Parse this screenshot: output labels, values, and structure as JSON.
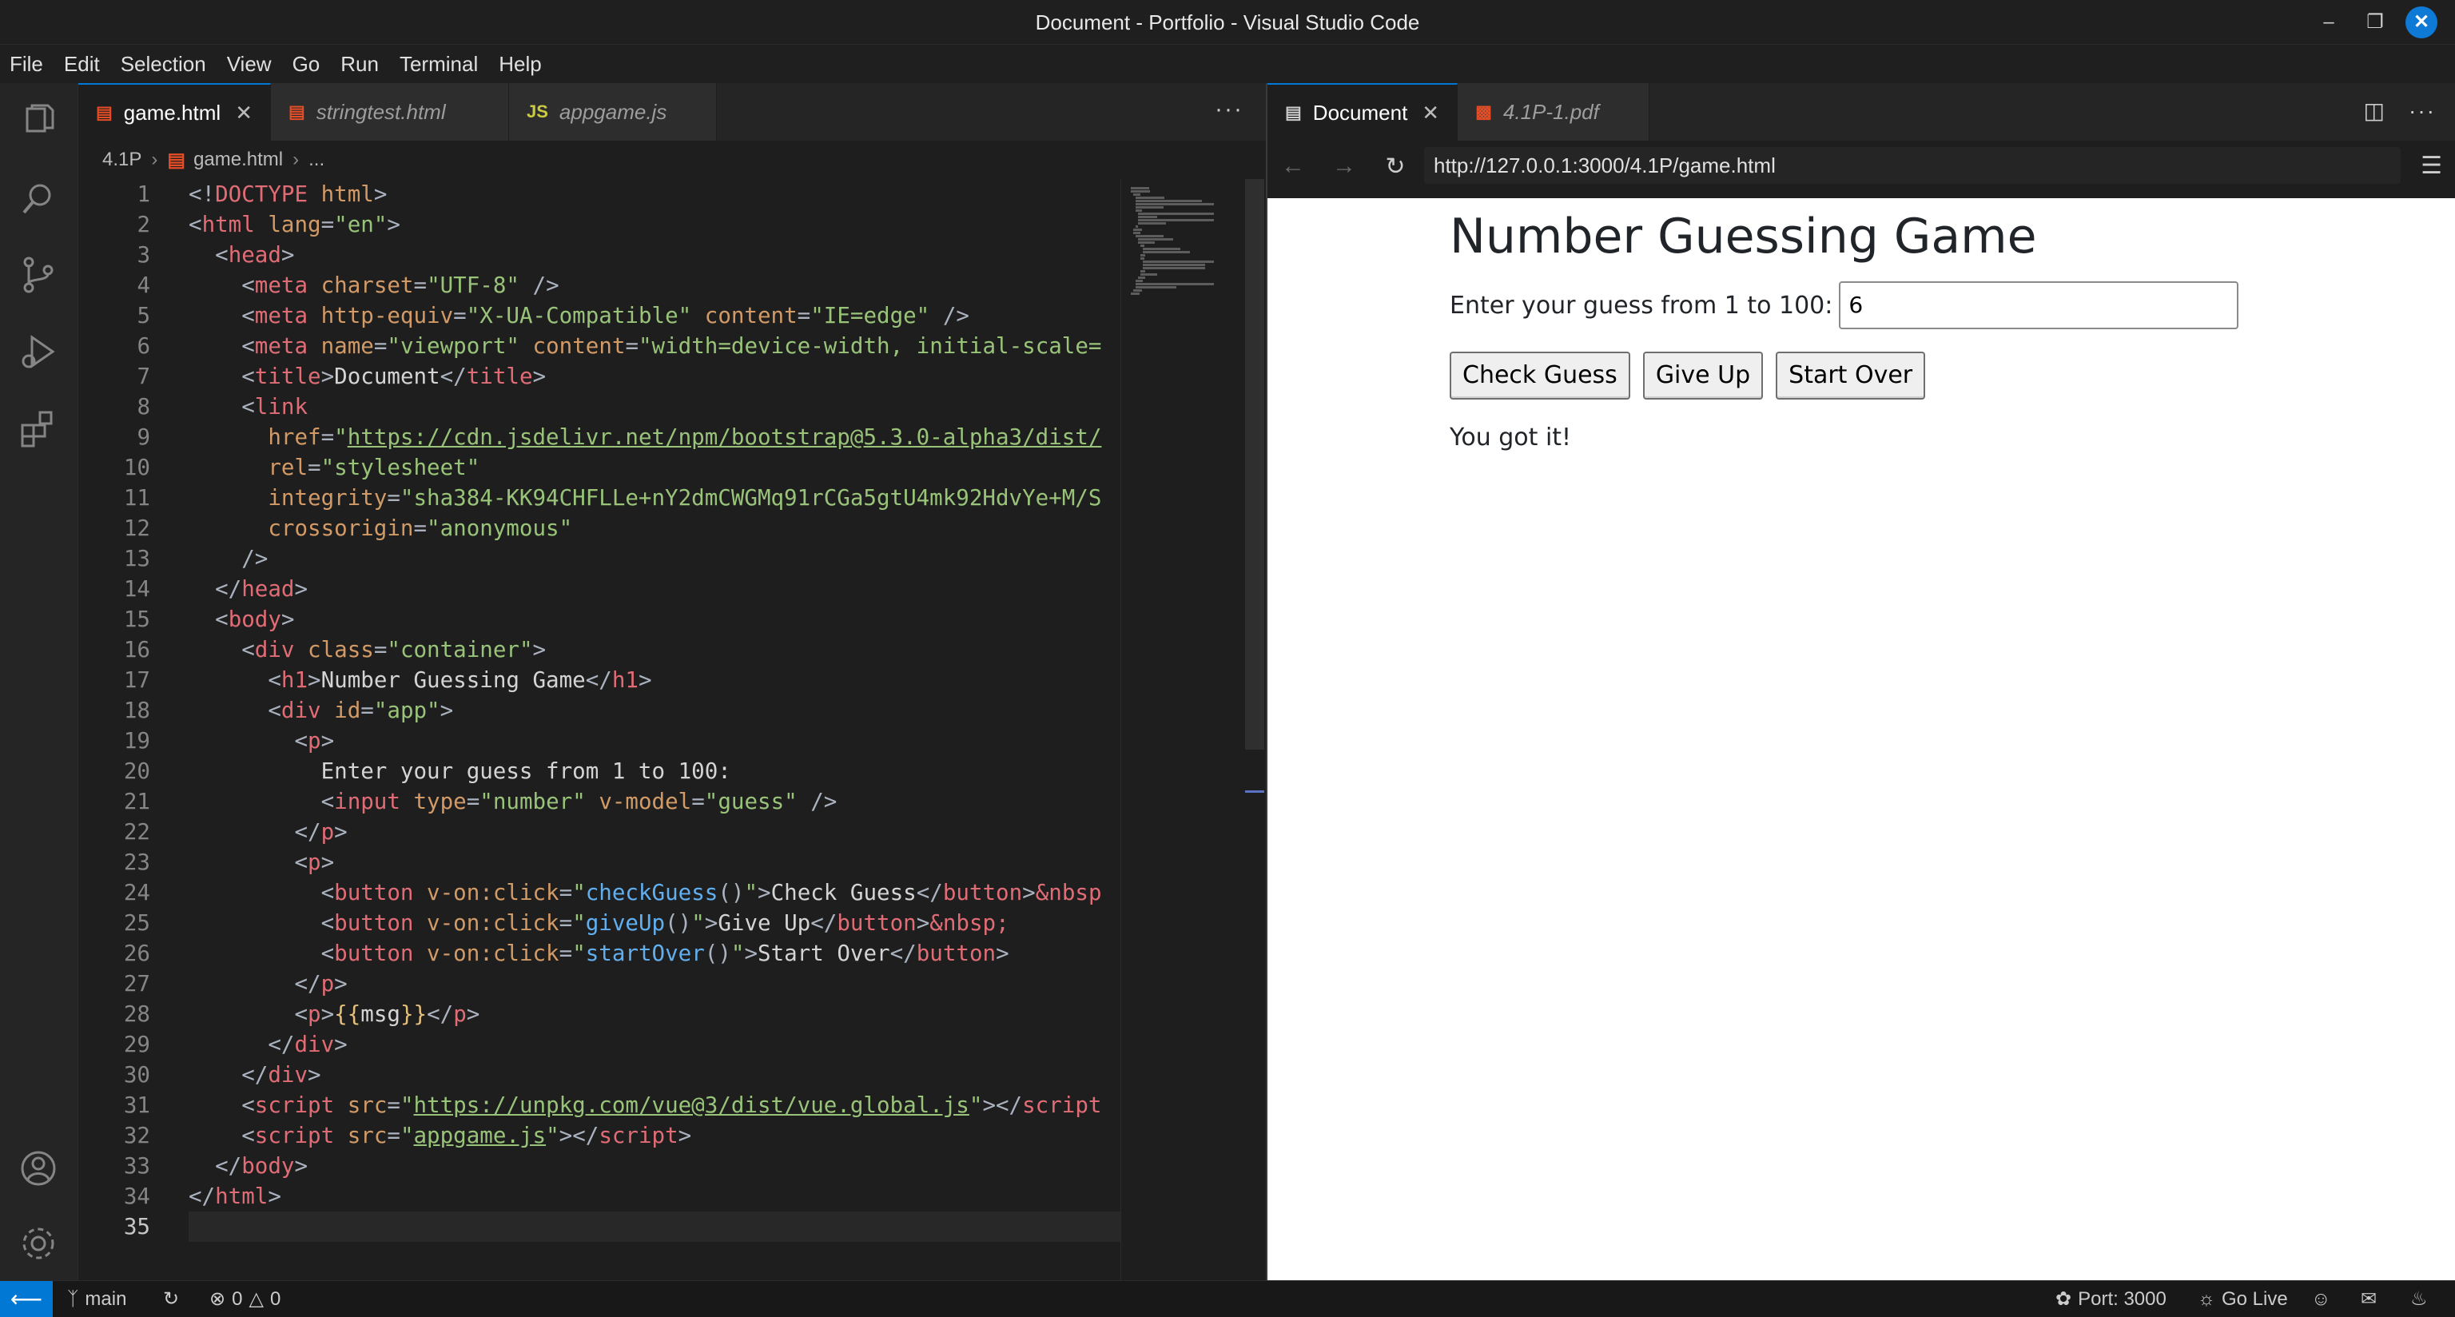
{
  "window": {
    "title": "Document - Portfolio - Visual Studio Code"
  },
  "menu": [
    "File",
    "Edit",
    "Selection",
    "View",
    "Go",
    "Run",
    "Terminal",
    "Help"
  ],
  "editor": {
    "tabs": [
      {
        "label": "game.html",
        "icon": "html5-icon",
        "active": true
      },
      {
        "label": "stringtest.html",
        "icon": "html5-icon",
        "active": false
      },
      {
        "label": "appgame.js",
        "icon": "js-icon",
        "active": false
      }
    ],
    "js_badge": "JS",
    "breadcrumb": {
      "folder": "4.1P",
      "file": "game.html",
      "symbol": "..."
    },
    "current_line": 35
  },
  "browser": {
    "tabs": [
      {
        "label": "Document",
        "icon": "preview-icon"
      },
      {
        "label": "4.1P-1.pdf",
        "icon": "pdf-icon"
      }
    ],
    "url": "http://127.0.0.1:3000/4.1P/game.html",
    "page": {
      "title": "Number Guessing Game",
      "prompt": "Enter your guess from 1 to 100:",
      "guess_value": "6",
      "buttons": {
        "check": "Check Guess",
        "give_up": "Give Up",
        "start_over": "Start Over"
      },
      "message": "You got it!"
    }
  },
  "status": {
    "branch": "main",
    "errors": "0",
    "warnings": "0",
    "port": "Port: 3000",
    "go_live": "Go Live"
  },
  "colors": {
    "accent": "#0078d4",
    "html_icon": "#e44d26",
    "js_icon": "#cbcb41"
  }
}
